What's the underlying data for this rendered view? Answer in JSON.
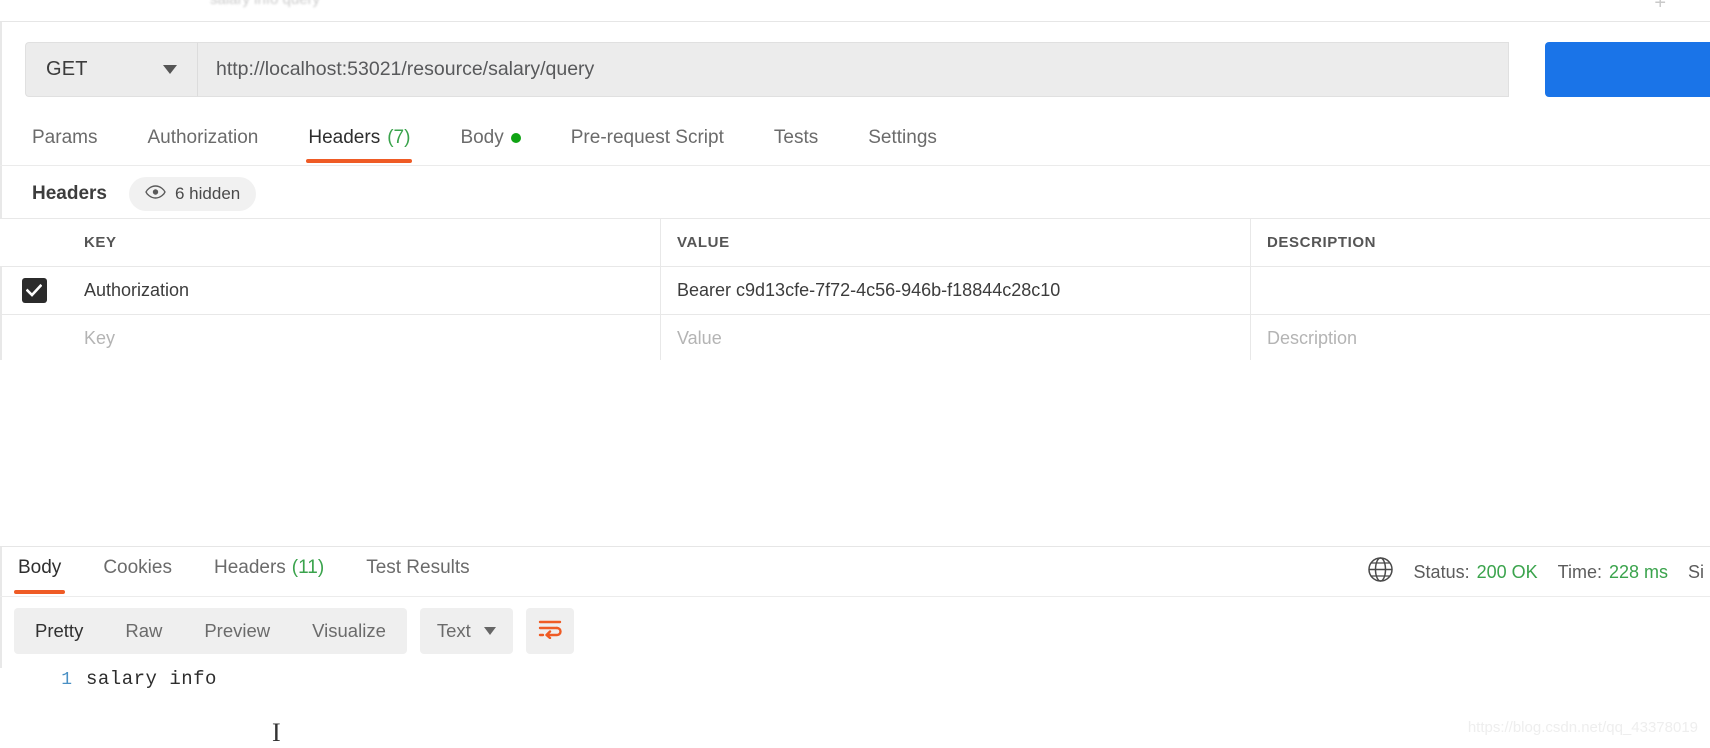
{
  "window": {
    "tabstrip_ghost_text": "salary info query",
    "add_tab_icon": "+"
  },
  "request": {
    "method": "GET",
    "url": "http://localhost:53021/resource/salary/query",
    "send_label": "",
    "tabs": [
      {
        "label": "Params",
        "active": false,
        "count": "",
        "dot": false
      },
      {
        "label": "Authorization",
        "active": false,
        "count": "",
        "dot": false
      },
      {
        "label": "Headers",
        "active": true,
        "count": "(7)",
        "dot": false
      },
      {
        "label": "Body",
        "active": false,
        "count": "",
        "dot": true
      },
      {
        "label": "Pre-request Script",
        "active": false,
        "count": "",
        "dot": false
      },
      {
        "label": "Tests",
        "active": false,
        "count": "",
        "dot": false
      },
      {
        "label": "Settings",
        "active": false,
        "count": "",
        "dot": false
      }
    ]
  },
  "headers_section": {
    "title": "Headers",
    "hidden_badge": "6 hidden",
    "columns": [
      "KEY",
      "VALUE",
      "DESCRIPTION"
    ],
    "rows": [
      {
        "checked": true,
        "key": "Authorization",
        "value": "Bearer c9d13cfe-7f72-4c56-946b-f18844c28c10",
        "description": ""
      }
    ],
    "placeholder_row": {
      "key": "Key",
      "value": "Value",
      "description": "Description"
    }
  },
  "response": {
    "tabs": [
      {
        "label": "Body",
        "active": true,
        "count": ""
      },
      {
        "label": "Cookies",
        "active": false,
        "count": ""
      },
      {
        "label": "Headers",
        "active": false,
        "count": "(11)"
      },
      {
        "label": "Test Results",
        "active": false,
        "count": ""
      }
    ],
    "status_label": "Status:",
    "status_value": "200 OK",
    "time_label": "Time:",
    "time_value": "228 ms",
    "size_label": "Si",
    "view_modes": [
      {
        "label": "Pretty",
        "active": true
      },
      {
        "label": "Raw",
        "active": false
      },
      {
        "label": "Preview",
        "active": false
      },
      {
        "label": "Visualize",
        "active": false
      }
    ],
    "format": "Text",
    "body_lines": [
      {
        "number": "1",
        "text": "salary info"
      }
    ]
  },
  "watermark": "https://blog.csdn.net/qq_43378019",
  "colors": {
    "accent_orange": "#ef5b25",
    "success_green": "#3aa34c",
    "send_blue": "#1a74e8",
    "body_dot_green": "#0fa313"
  }
}
